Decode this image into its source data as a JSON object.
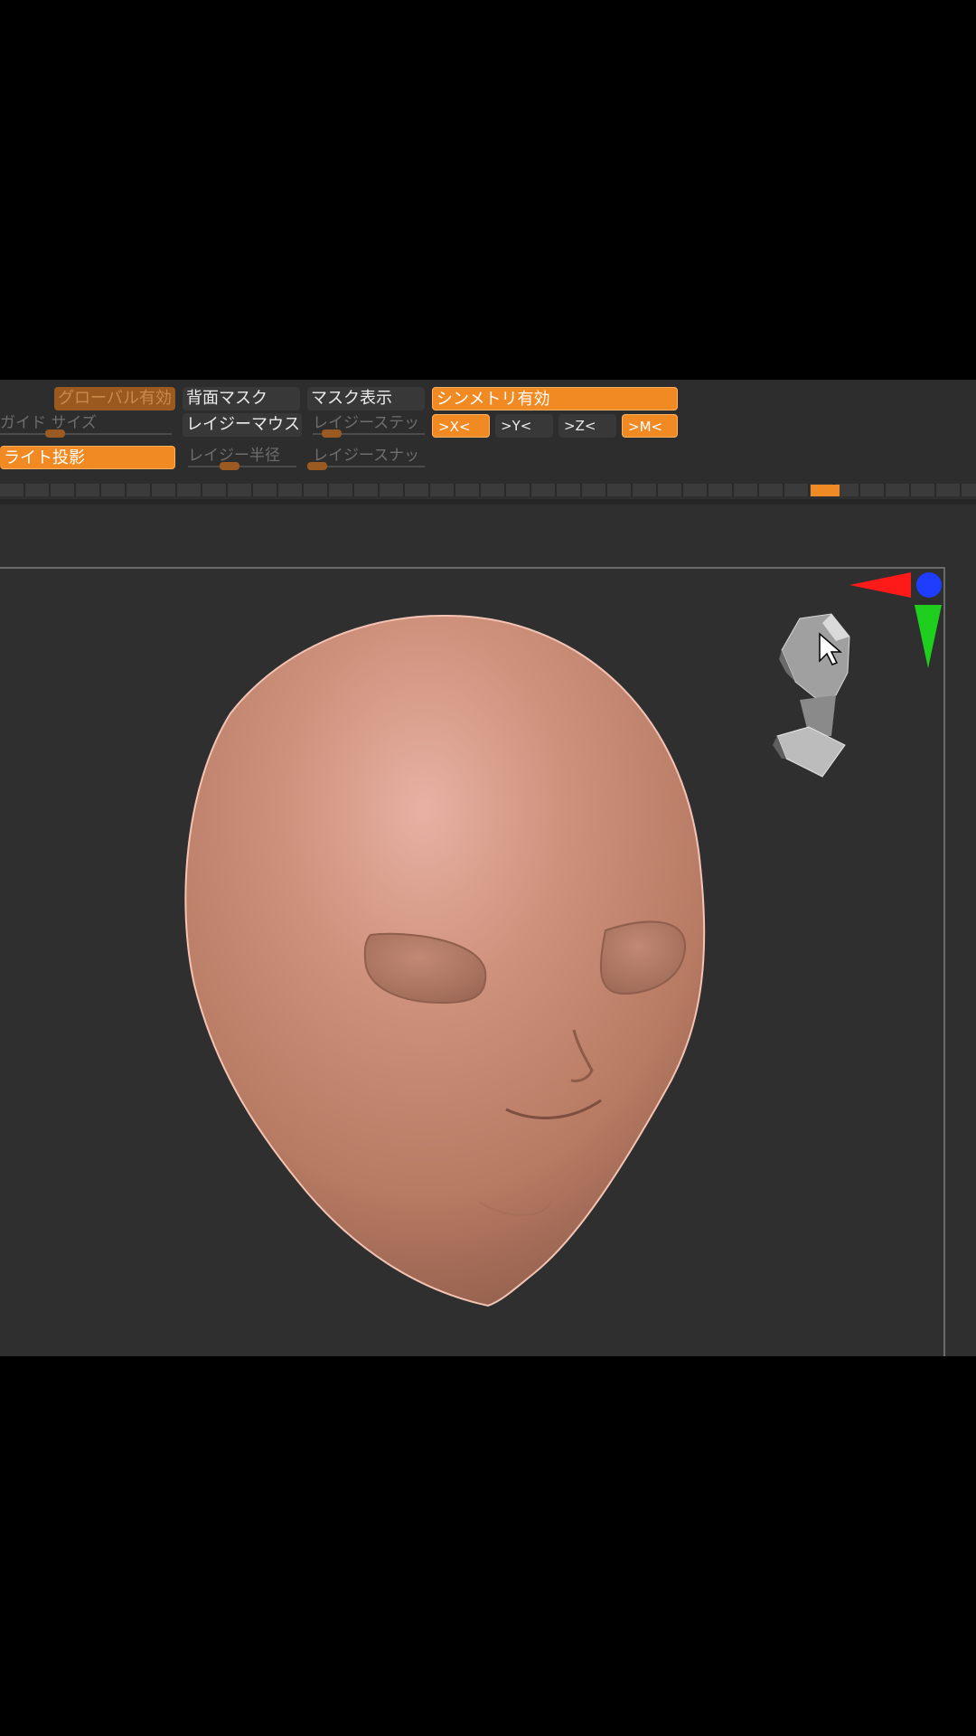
{
  "toolbar": {
    "row1": {
      "global_enable": "グローバル有効",
      "backface_mask": "背面マスク",
      "mask_display": "マスク表示",
      "symmetry_enable": "シンメトリ有効"
    },
    "row2": {
      "guide_size": "ガイド サイズ",
      "lazy_mouse": "レイジーマウス",
      "lazy_step": "レイジーステッ",
      "axis_x": ">X<",
      "axis_y": ">Y<",
      "axis_z": ">Z<",
      "axis_m": ">M<"
    },
    "row3": {
      "light_projection": "ライト投影",
      "lazy_radius": "レイジー半径",
      "lazy_snap": "レイジースナッ"
    }
  },
  "colors": {
    "accent": "#f28a24",
    "panel": "#2f2f2f",
    "skin": "#c88a73"
  },
  "icons": {
    "gizmo_x": "red-arrow-icon",
    "gizmo_y": "green-arrow-icon",
    "gizmo_z": "blue-sphere-icon",
    "nav_head": "mannequin-head-icon",
    "cursor": "mouse-cursor-icon"
  }
}
